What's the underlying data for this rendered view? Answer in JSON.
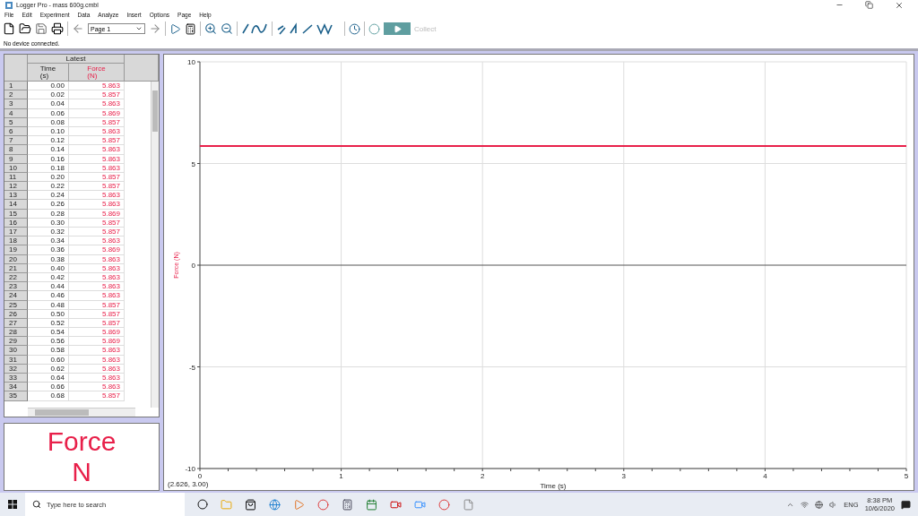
{
  "window": {
    "title": "Logger Pro - mass 600g.cmbl"
  },
  "menu": [
    "File",
    "Edit",
    "Experiment",
    "Data",
    "Analyze",
    "Insert",
    "Options",
    "Page",
    "Help"
  ],
  "toolbar": {
    "page": "Page 1",
    "collect": {
      "label": "Collect",
      "disabled": true
    }
  },
  "status": "No device connected.",
  "table": {
    "group": "Latest",
    "columns": [
      {
        "name": "Time",
        "unit": "(s)"
      },
      {
        "name": "Force",
        "unit": "(N)"
      }
    ],
    "rows": [
      {
        "n": "1",
        "time": "0.00",
        "force": "5.863"
      },
      {
        "n": "2",
        "time": "0.02",
        "force": "5.857"
      },
      {
        "n": "3",
        "time": "0.04",
        "force": "5.863"
      },
      {
        "n": "4",
        "time": "0.06",
        "force": "5.869"
      },
      {
        "n": "5",
        "time": "0.08",
        "force": "5.857"
      },
      {
        "n": "6",
        "time": "0.10",
        "force": "5.863"
      },
      {
        "n": "7",
        "time": "0.12",
        "force": "5.857"
      },
      {
        "n": "8",
        "time": "0.14",
        "force": "5.863"
      },
      {
        "n": "9",
        "time": "0.16",
        "force": "5.863"
      },
      {
        "n": "10",
        "time": "0.18",
        "force": "5.863"
      },
      {
        "n": "11",
        "time": "0.20",
        "force": "5.857"
      },
      {
        "n": "12",
        "time": "0.22",
        "force": "5.857"
      },
      {
        "n": "13",
        "time": "0.24",
        "force": "5.863"
      },
      {
        "n": "14",
        "time": "0.26",
        "force": "5.863"
      },
      {
        "n": "15",
        "time": "0.28",
        "force": "5.869"
      },
      {
        "n": "16",
        "time": "0.30",
        "force": "5.857"
      },
      {
        "n": "17",
        "time": "0.32",
        "force": "5.857"
      },
      {
        "n": "18",
        "time": "0.34",
        "force": "5.863"
      },
      {
        "n": "19",
        "time": "0.36",
        "force": "5.869"
      },
      {
        "n": "20",
        "time": "0.38",
        "force": "5.863"
      },
      {
        "n": "21",
        "time": "0.40",
        "force": "5.863"
      },
      {
        "n": "22",
        "time": "0.42",
        "force": "5.863"
      },
      {
        "n": "23",
        "time": "0.44",
        "force": "5.863"
      },
      {
        "n": "24",
        "time": "0.46",
        "force": "5.863"
      },
      {
        "n": "25",
        "time": "0.48",
        "force": "5.857"
      },
      {
        "n": "26",
        "time": "0.50",
        "force": "5.857"
      },
      {
        "n": "27",
        "time": "0.52",
        "force": "5.857"
      },
      {
        "n": "28",
        "time": "0.54",
        "force": "5.869"
      },
      {
        "n": "29",
        "time": "0.56",
        "force": "5.869"
      },
      {
        "n": "30",
        "time": "0.58",
        "force": "5.863"
      },
      {
        "n": "31",
        "time": "0.60",
        "force": "5.863"
      },
      {
        "n": "32",
        "time": "0.62",
        "force": "5.863"
      },
      {
        "n": "33",
        "time": "0.64",
        "force": "5.863"
      },
      {
        "n": "34",
        "time": "0.66",
        "force": "5.863"
      },
      {
        "n": "35",
        "time": "0.68",
        "force": "5.857"
      }
    ]
  },
  "meter": {
    "name": "Force",
    "unit": "N"
  },
  "graph": {
    "readout": "(2.626, 3.00)",
    "chart_data": {
      "type": "line",
      "xlabel": "Time (s)",
      "ylabel": "Force (N)",
      "x": [
        0,
        5
      ],
      "grid": true,
      "series": [
        {
          "color": "#e8204a",
          "values": [
            5.86,
            5.86
          ]
        }
      ],
      "xlim": [
        0,
        5
      ],
      "ylim": [
        -10,
        10
      ],
      "xticks": [
        0,
        1,
        2,
        3,
        4,
        5
      ],
      "yticks": [
        -10,
        -5,
        0,
        5,
        10
      ]
    }
  },
  "taskbar": {
    "search": {
      "placeholder": "Type here to search"
    },
    "language": "ENG",
    "time": "8:38 PM",
    "date": "10/6/2020"
  }
}
